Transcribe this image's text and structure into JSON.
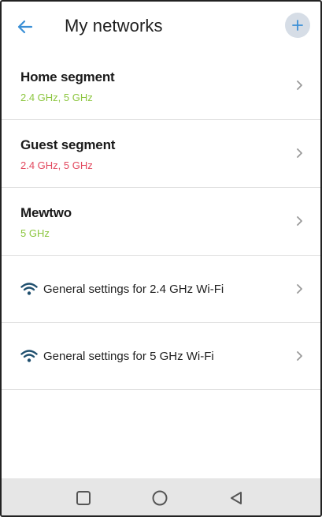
{
  "header": {
    "title": "My networks",
    "back_icon": "arrow-left-icon",
    "add_icon": "plus-icon"
  },
  "networks": [
    {
      "name": "Home segment",
      "bands": "2.4 GHz, 5 GHz",
      "band_color": "#8cc63f"
    },
    {
      "name": "Guest segment",
      "bands": "2.4 GHz, 5 GHz",
      "band_color": "#e2485e"
    },
    {
      "name": "Mewtwo",
      "bands": "5 GHz",
      "band_color": "#8cc63f"
    }
  ],
  "general_settings": [
    {
      "label": "General settings for 2.4 GHz Wi-Fi",
      "icon": "wifi-icon"
    },
    {
      "label": "General settings for 5 GHz Wi-Fi",
      "icon": "wifi-icon"
    }
  ],
  "navbar": {
    "recent_icon": "square-icon",
    "home_icon": "circle-icon",
    "back_icon": "triangle-back-icon"
  },
  "colors": {
    "accent": "#3a8fd6",
    "green": "#8cc63f",
    "red": "#e2485e",
    "wifi": "#1f4f6e"
  }
}
